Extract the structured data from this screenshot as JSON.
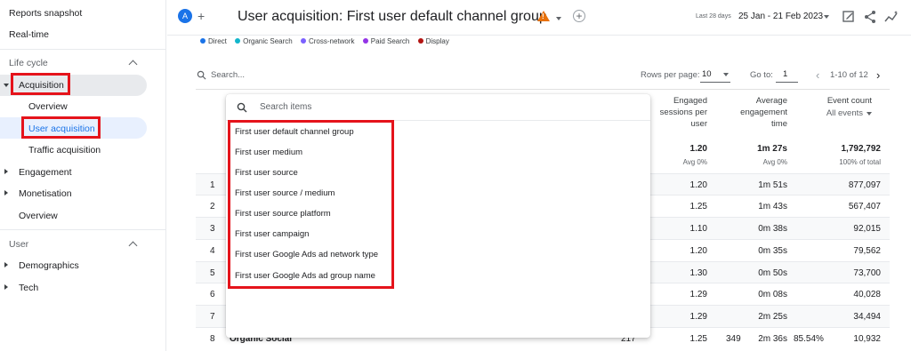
{
  "sidebar": {
    "reports_snapshot": "Reports snapshot",
    "realtime": "Real-time",
    "lifecycle_section": "Life cycle",
    "acquisition": "Acquisition",
    "overview": "Overview",
    "user_acquisition": "User acquisition",
    "traffic_acquisition": "Traffic acquisition",
    "engagement": "Engagement",
    "monetisation": "Monetisation",
    "overview2": "Overview",
    "user_section": "User",
    "demographics": "Demographics",
    "tech": "Tech"
  },
  "header": {
    "avatar_letter": "A",
    "title": "User acquisition: First user default channel group",
    "date_label": "Last 28 days",
    "date_range": "25 Jan - 21 Feb 2023"
  },
  "legend": [
    {
      "label": "Direct",
      "color": "#1a73e8"
    },
    {
      "label": "Organic Search",
      "color": "#12b5cb"
    },
    {
      "label": "Cross-network",
      "color": "#7b61ff"
    },
    {
      "label": "Paid Search",
      "color": "#9334e6"
    },
    {
      "label": "Display",
      "color": "#b31412"
    }
  ],
  "toolbar": {
    "search_placeholder": "Search...",
    "rows_per_page_label": "Rows per page:",
    "rows_per_page_value": "10",
    "goto_label": "Go to:",
    "goto_value": "1",
    "pagination": "1-10 of 12"
  },
  "columns": {
    "engaged_sessions": [
      "Engaged",
      "sessions per",
      "user"
    ],
    "avg_engagement": [
      "Average",
      "engagement",
      "time"
    ],
    "event_count": "Event count",
    "event_count_sub": "All events"
  },
  "totals": {
    "engaged_sessions": "1.20",
    "engaged_sessions_sub": "Avg 0%",
    "avg_engagement": "1m 27s",
    "avg_engagement_sub": "Avg 0%",
    "event_count": "1,792,792",
    "event_count_sub": "100% of total"
  },
  "rows": [
    {
      "num": "1",
      "eng": "1.20",
      "time": "1m 51s",
      "events": "877,097"
    },
    {
      "num": "2",
      "eng": "1.25",
      "time": "1m 43s",
      "events": "567,407"
    },
    {
      "num": "3",
      "eng": "1.10",
      "time": "0m 38s",
      "events": "92,015"
    },
    {
      "num": "4",
      "eng": "1.20",
      "time": "0m 35s",
      "events": "79,562"
    },
    {
      "num": "5",
      "eng": "1.30",
      "time": "0m 50s",
      "events": "73,700"
    },
    {
      "num": "6",
      "eng": "1.29",
      "time": "0m 08s",
      "events": "40,028"
    },
    {
      "num": "7",
      "eng": "1.29",
      "time": "2m 25s",
      "events": "34,494"
    },
    {
      "num": "8",
      "eng": "1.25",
      "time": "2m 36s",
      "events": "10,932",
      "label": "Organic Social",
      "users": "217",
      "new_users": "349",
      "rate": "85.54%"
    }
  ],
  "dropdown": {
    "search_placeholder": "Search items",
    "options": [
      "First user default channel group",
      "First user medium",
      "First user source",
      "First user source / medium",
      "First user source platform",
      "First user campaign",
      "First user Google Ads ad network type",
      "First user Google Ads ad group name"
    ]
  },
  "colors": {
    "highlight_red": "#e5131b",
    "accent_blue": "#1a73e8",
    "warning_orange": "#e8710a"
  }
}
